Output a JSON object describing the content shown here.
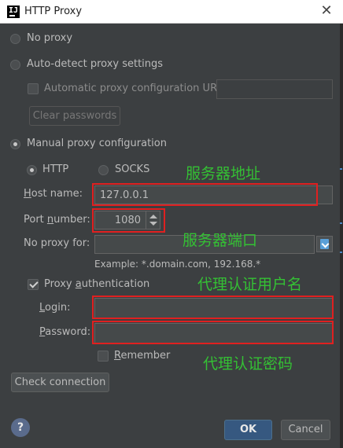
{
  "window": {
    "title": "HTTP Proxy",
    "app_icon": "intellij-icon",
    "close_icon": "close-icon"
  },
  "options": {
    "no_proxy": {
      "label": "No proxy",
      "selected": false
    },
    "auto_detect": {
      "label": "Auto-detect proxy settings",
      "selected": false
    },
    "auto_config_url": {
      "label": "Automatic proxy configuration URL:",
      "checked": false,
      "value": ""
    },
    "clear_passwords": "Clear passwords",
    "manual": {
      "label": "Manual proxy configuration",
      "selected": true
    }
  },
  "protocol": {
    "http": {
      "label": "HTTP",
      "selected": true
    },
    "socks": {
      "label": "SOCKS",
      "selected": false
    }
  },
  "host": {
    "label": "Host name:",
    "label_mnemonic": "H",
    "label_rest": "ost name:",
    "value": "127.0.0.1"
  },
  "port": {
    "label": "Port number:",
    "label_pre": "Port ",
    "label_mnemonic": "n",
    "label_rest": "umber:",
    "value": "1080"
  },
  "no_proxy_for": {
    "label": "No proxy for:",
    "value": "",
    "example": "Example: *.domain.com, 192.168.*"
  },
  "auth": {
    "label": "Proxy authentication",
    "label_pre": "Proxy ",
    "label_mnemonic": "a",
    "label_rest": "uthentication",
    "checked": true,
    "login": {
      "label": "Login:",
      "label_mnemonic": "L",
      "label_rest": "ogin:",
      "value": ""
    },
    "password": {
      "label": "Password:",
      "label_mnemonic": "P",
      "label_rest": "assword:",
      "value": ""
    },
    "remember": {
      "label": "Remember",
      "label_mnemonic": "R",
      "label_rest": "emember",
      "checked": false
    }
  },
  "check_connection": "Check connection",
  "footer": {
    "help": "?",
    "ok": "OK",
    "cancel": "Cancel"
  },
  "annotations": {
    "server_address": "服务器地址",
    "server_port": "服务器端口",
    "proxy_username": "代理认证用户名",
    "proxy_password": "代理认证密码"
  },
  "colors": {
    "background": "#3c3f41",
    "annotation_text": "#34c034",
    "annotation_box": "#e02020",
    "primary_button": "#365880"
  }
}
